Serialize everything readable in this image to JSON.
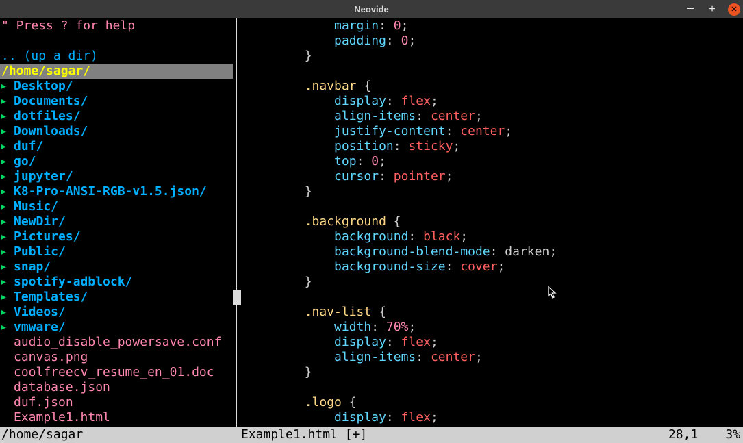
{
  "window": {
    "title": "Neovide"
  },
  "tree": {
    "help": "\" Press ? for help",
    "updir": ".. (up a dir)",
    "path": "/home/sagar/",
    "entries": [
      {
        "name": "Desktop/",
        "dir": true
      },
      {
        "name": "Documents/",
        "dir": true
      },
      {
        "name": "dotfiles/",
        "dir": true
      },
      {
        "name": "Downloads/",
        "dir": true
      },
      {
        "name": "duf/",
        "dir": true
      },
      {
        "name": "go/",
        "dir": true
      },
      {
        "name": "jupyter/",
        "dir": true
      },
      {
        "name": "K8-Pro-ANSI-RGB-v1.5.json/",
        "dir": true
      },
      {
        "name": "Music/",
        "dir": true
      },
      {
        "name": "NewDir/",
        "dir": true
      },
      {
        "name": "Pictures/",
        "dir": true
      },
      {
        "name": "Public/",
        "dir": true
      },
      {
        "name": "snap/",
        "dir": true
      },
      {
        "name": "spotify-adblock/",
        "dir": true
      },
      {
        "name": "Templates/",
        "dir": true
      },
      {
        "name": "Videos/",
        "dir": true
      },
      {
        "name": "vmware/",
        "dir": true
      },
      {
        "name": "audio_disable_powersave.conf",
        "dir": false
      },
      {
        "name": "canvas.png",
        "dir": false
      },
      {
        "name": "coolfreecv_resume_en_01.doc",
        "dir": false
      },
      {
        "name": "database.json",
        "dir": false
      },
      {
        "name": "duf.json",
        "dir": false
      },
      {
        "name": "Example1.html",
        "dir": false
      }
    ]
  },
  "code": {
    "lines": [
      [
        {
          "t": "            ",
          "c": "plain"
        },
        {
          "t": "margin",
          "c": "prop"
        },
        {
          "t": ": ",
          "c": "punc"
        },
        {
          "t": "0",
          "c": "num"
        },
        {
          "t": ";",
          "c": "punc"
        }
      ],
      [
        {
          "t": "            ",
          "c": "plain"
        },
        {
          "t": "padding",
          "c": "prop"
        },
        {
          "t": ": ",
          "c": "punc"
        },
        {
          "t": "0",
          "c": "num"
        },
        {
          "t": ";",
          "c": "punc"
        }
      ],
      [
        {
          "t": "        }",
          "c": "brace"
        }
      ],
      [],
      [
        {
          "t": "        ",
          "c": "plain"
        },
        {
          "t": ".navbar",
          "c": "sel"
        },
        {
          "t": " {",
          "c": "brace"
        }
      ],
      [
        {
          "t": "            ",
          "c": "plain"
        },
        {
          "t": "display",
          "c": "prop"
        },
        {
          "t": ": ",
          "c": "punc"
        },
        {
          "t": "flex",
          "c": "val"
        },
        {
          "t": ";",
          "c": "punc"
        }
      ],
      [
        {
          "t": "            ",
          "c": "plain"
        },
        {
          "t": "align-items",
          "c": "prop"
        },
        {
          "t": ": ",
          "c": "punc"
        },
        {
          "t": "center",
          "c": "val"
        },
        {
          "t": ";",
          "c": "punc"
        }
      ],
      [
        {
          "t": "            ",
          "c": "plain"
        },
        {
          "t": "justify-content",
          "c": "prop"
        },
        {
          "t": ": ",
          "c": "punc"
        },
        {
          "t": "center",
          "c": "val"
        },
        {
          "t": ";",
          "c": "punc"
        }
      ],
      [
        {
          "t": "            ",
          "c": "plain"
        },
        {
          "t": "position",
          "c": "prop"
        },
        {
          "t": ": ",
          "c": "punc"
        },
        {
          "t": "sticky",
          "c": "val"
        },
        {
          "t": ";",
          "c": "punc"
        }
      ],
      [
        {
          "t": "            ",
          "c": "plain"
        },
        {
          "t": "top",
          "c": "prop"
        },
        {
          "t": ": ",
          "c": "punc"
        },
        {
          "t": "0",
          "c": "num"
        },
        {
          "t": ";",
          "c": "punc"
        }
      ],
      [
        {
          "t": "            ",
          "c": "plain"
        },
        {
          "t": "cursor",
          "c": "prop"
        },
        {
          "t": ": ",
          "c": "punc"
        },
        {
          "t": "pointer",
          "c": "val"
        },
        {
          "t": ";",
          "c": "punc"
        }
      ],
      [
        {
          "t": "        }",
          "c": "brace"
        }
      ],
      [],
      [
        {
          "t": "        ",
          "c": "plain"
        },
        {
          "t": ".background",
          "c": "sel"
        },
        {
          "t": " {",
          "c": "brace"
        }
      ],
      [
        {
          "t": "            ",
          "c": "plain"
        },
        {
          "t": "background",
          "c": "prop"
        },
        {
          "t": ": ",
          "c": "punc"
        },
        {
          "t": "black",
          "c": "val"
        },
        {
          "t": ";",
          "c": "punc"
        }
      ],
      [
        {
          "t": "            ",
          "c": "plain"
        },
        {
          "t": "background-blend-mode",
          "c": "prop"
        },
        {
          "t": ": darken;",
          "c": "plain"
        }
      ],
      [
        {
          "t": "            ",
          "c": "plain"
        },
        {
          "t": "background-size",
          "c": "prop"
        },
        {
          "t": ": ",
          "c": "punc"
        },
        {
          "t": "cover",
          "c": "val"
        },
        {
          "t": ";",
          "c": "punc"
        }
      ],
      [
        {
          "t": "        }",
          "c": "brace"
        }
      ],
      [],
      [
        {
          "t": "        ",
          "c": "plain"
        },
        {
          "t": ".nav-list",
          "c": "sel"
        },
        {
          "t": " {",
          "c": "brace"
        }
      ],
      [
        {
          "t": "            ",
          "c": "plain"
        },
        {
          "t": "width",
          "c": "prop"
        },
        {
          "t": ": ",
          "c": "punc"
        },
        {
          "t": "70%",
          "c": "num"
        },
        {
          "t": ";",
          "c": "punc"
        }
      ],
      [
        {
          "t": "            ",
          "c": "plain"
        },
        {
          "t": "display",
          "c": "prop"
        },
        {
          "t": ": ",
          "c": "punc"
        },
        {
          "t": "flex",
          "c": "val"
        },
        {
          "t": ";",
          "c": "punc"
        }
      ],
      [
        {
          "t": "            ",
          "c": "plain"
        },
        {
          "t": "align-items",
          "c": "prop"
        },
        {
          "t": ": ",
          "c": "punc"
        },
        {
          "t": "center",
          "c": "val"
        },
        {
          "t": ";",
          "c": "punc"
        }
      ],
      [
        {
          "t": "        }",
          "c": "brace"
        }
      ],
      [],
      [
        {
          "t": "        ",
          "c": "plain"
        },
        {
          "t": ".logo",
          "c": "sel"
        },
        {
          "t": " {",
          "c": "brace"
        }
      ],
      [
        {
          "t": "            ",
          "c": "plain"
        },
        {
          "t": "display",
          "c": "prop"
        },
        {
          "t": ": ",
          "c": "punc"
        },
        {
          "t": "flex",
          "c": "val"
        },
        {
          "t": ";",
          "c": "punc"
        }
      ]
    ]
  },
  "status": {
    "left": "/home/sagar",
    "mid": "Example1.html [+]",
    "pos": "28,1",
    "pct": "3%"
  }
}
